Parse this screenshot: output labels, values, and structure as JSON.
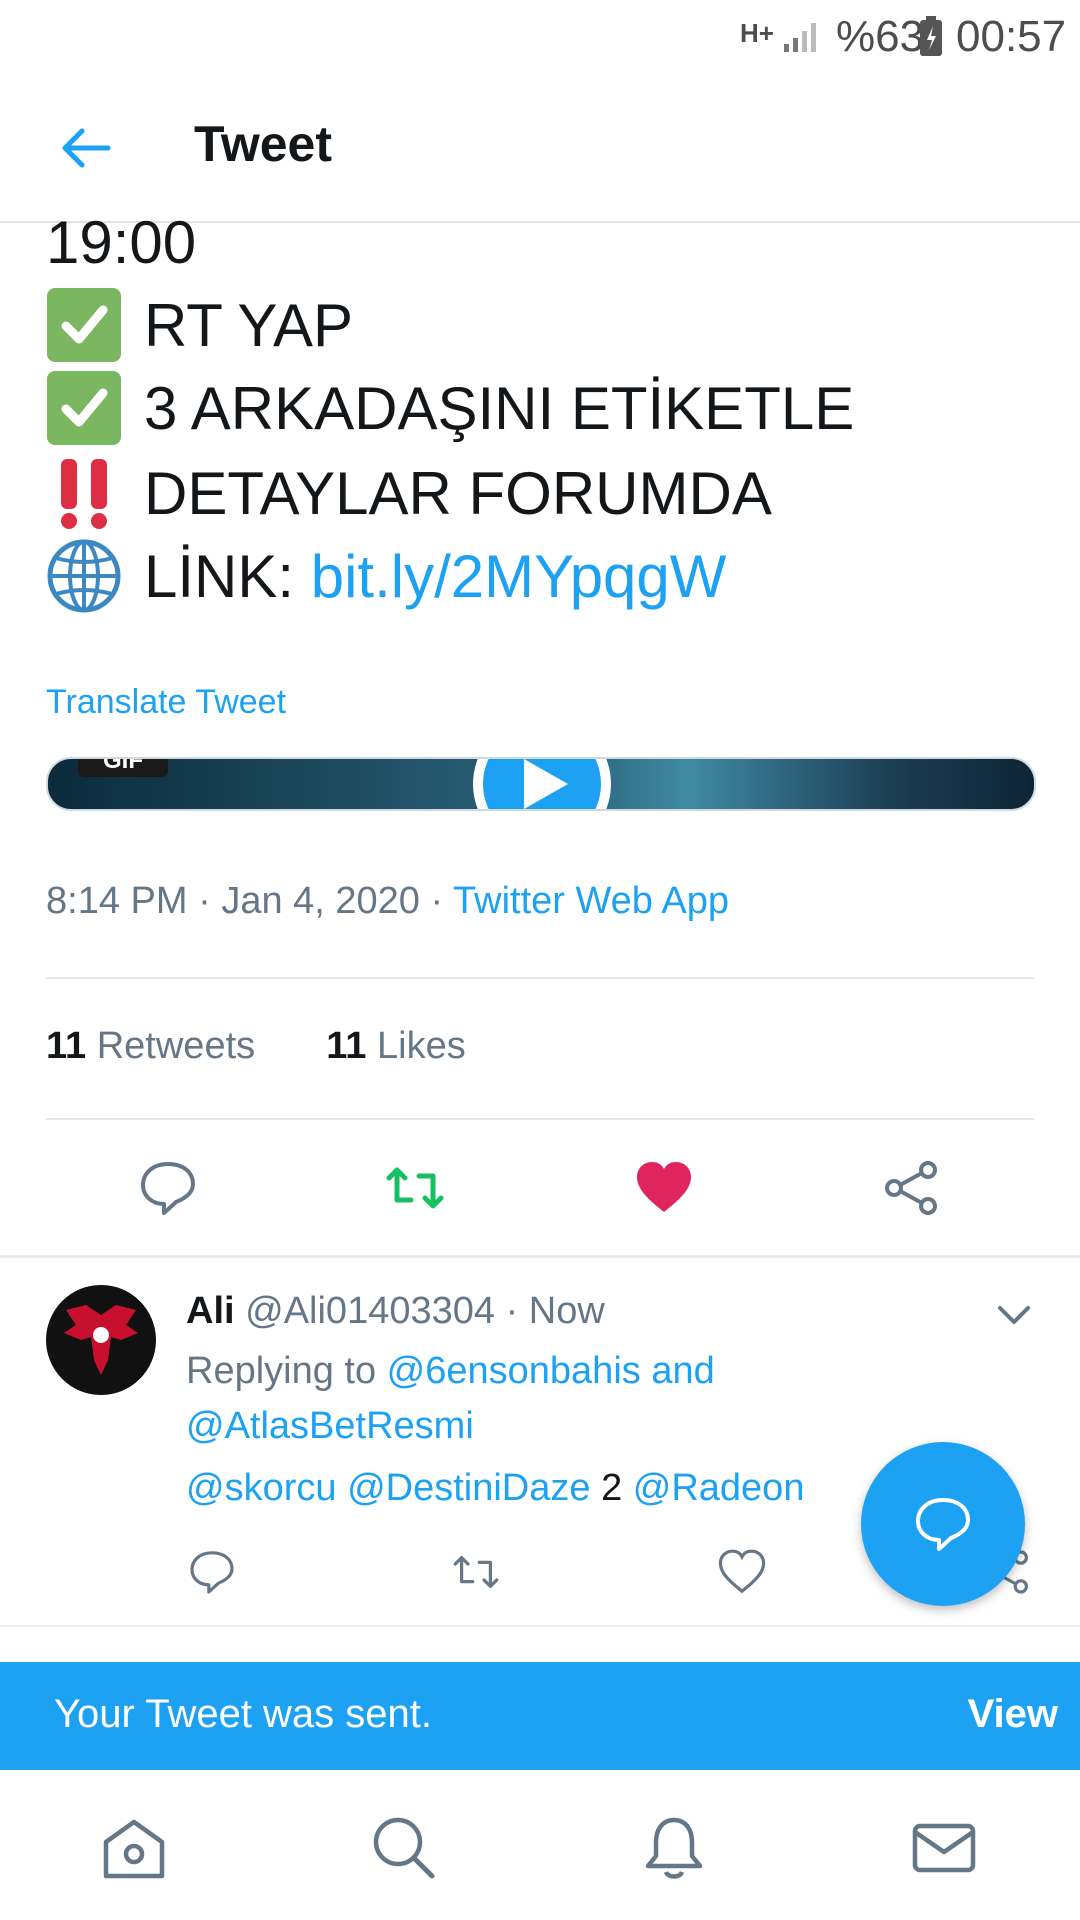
{
  "status_bar": {
    "network": "H+",
    "battery": "%63",
    "time": "00:57"
  },
  "header": {
    "title": "Tweet"
  },
  "tweet": {
    "lines": [
      {
        "text": "19:00"
      },
      {
        "emoji": "check-mark-button-icon",
        "text": "RT YAP"
      },
      {
        "emoji": "check-mark-button-icon",
        "text": "3 ARKADAŞINI ETİKETLE"
      },
      {
        "emoji": "double-exclamation-icon",
        "text": "DETAYLAR FORUMDA"
      },
      {
        "emoji": "globe-icon",
        "label": "LİNK: ",
        "link": "bit.ly/2MYpqgW"
      }
    ],
    "translate": "Translate Tweet",
    "media_badge": "GIF",
    "time": "8:14 PM",
    "date": "Jan 4, 2020",
    "source": "Twitter Web App",
    "retweets_count": "11",
    "retweets_label": "Retweets",
    "likes_count": "11",
    "likes_label": "Likes",
    "liked": true,
    "colors": {
      "accent": "#1da1f2",
      "retweet": "#17bf63",
      "like": "#e0245e"
    }
  },
  "reply": {
    "name": "Ali",
    "handle": "@Ali01403304",
    "time": "Now",
    "replying_prefix": "Replying to ",
    "replying_to_1": "@6ensonbahis and",
    "replying_to_2": "@AtlasBetResmi",
    "body": [
      {
        "text": "@skorcu",
        "type": "mention"
      },
      {
        "text": "@DestiniDaze",
        "type": "mention"
      },
      {
        "text": "2",
        "type": "text"
      },
      {
        "text": "@Radeon",
        "type": "mention"
      }
    ]
  },
  "toast": {
    "message": "Your Tweet was sent.",
    "action": "View"
  }
}
